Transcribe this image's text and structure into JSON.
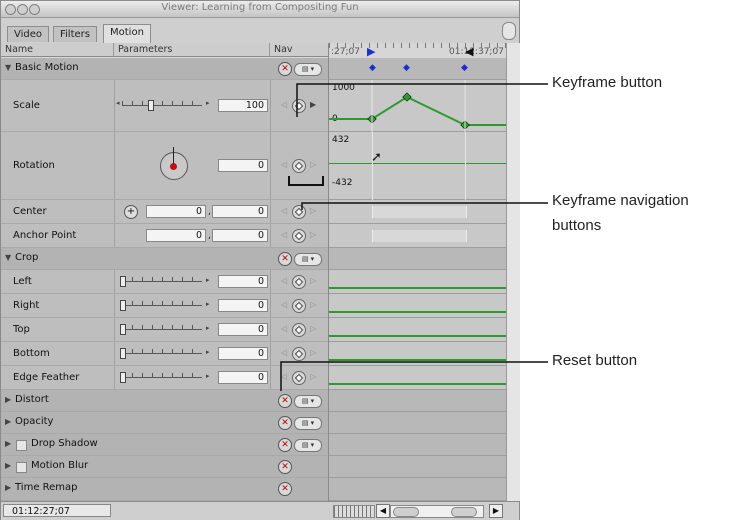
{
  "window": {
    "title": "Viewer: Learning from Compositing Fun"
  },
  "tabs": [
    "Video",
    "Filters",
    "Motion"
  ],
  "columns": {
    "name": "Name",
    "parameters": "Parameters",
    "nav": "Nav"
  },
  "timeline": {
    "ruler_left": ":27;07",
    "ruler_right": "01:12:37;07",
    "scale_top": "1000",
    "scale_zero": "0",
    "rot_top": "432",
    "rot_bottom": "-432"
  },
  "rows": {
    "basic_motion": "Basic Motion",
    "scale": {
      "label": "Scale",
      "value": "100"
    },
    "rotation": {
      "label": "Rotation",
      "value": "0"
    },
    "center": {
      "label": "Center",
      "x": "0",
      "y": "0"
    },
    "anchor": {
      "label": "Anchor Point",
      "x": "0",
      "y": "0"
    },
    "crop": "Crop",
    "left": {
      "label": "Left",
      "value": "0"
    },
    "right": {
      "label": "Right",
      "value": "0"
    },
    "top": {
      "label": "Top",
      "value": "0"
    },
    "bottom": {
      "label": "Bottom",
      "value": "0"
    },
    "edge": {
      "label": "Edge Feather",
      "value": "0"
    },
    "distort": "Distort",
    "opacity": "Opacity",
    "drop_shadow": "Drop Shadow",
    "motion_blur": "Motion Blur",
    "time_remap": "Time Remap"
  },
  "status": {
    "timecode": "01:12:27;07"
  },
  "callouts": {
    "keyframe_button": "Keyframe button",
    "nav_line1": "Keyframe navigation",
    "nav_line2": "buttons",
    "reset_button": "Reset button"
  },
  "colors": {
    "curve": "#2e9a2e",
    "keyframe_marker": "#1a2fd0",
    "reset_x": "#b00000"
  }
}
